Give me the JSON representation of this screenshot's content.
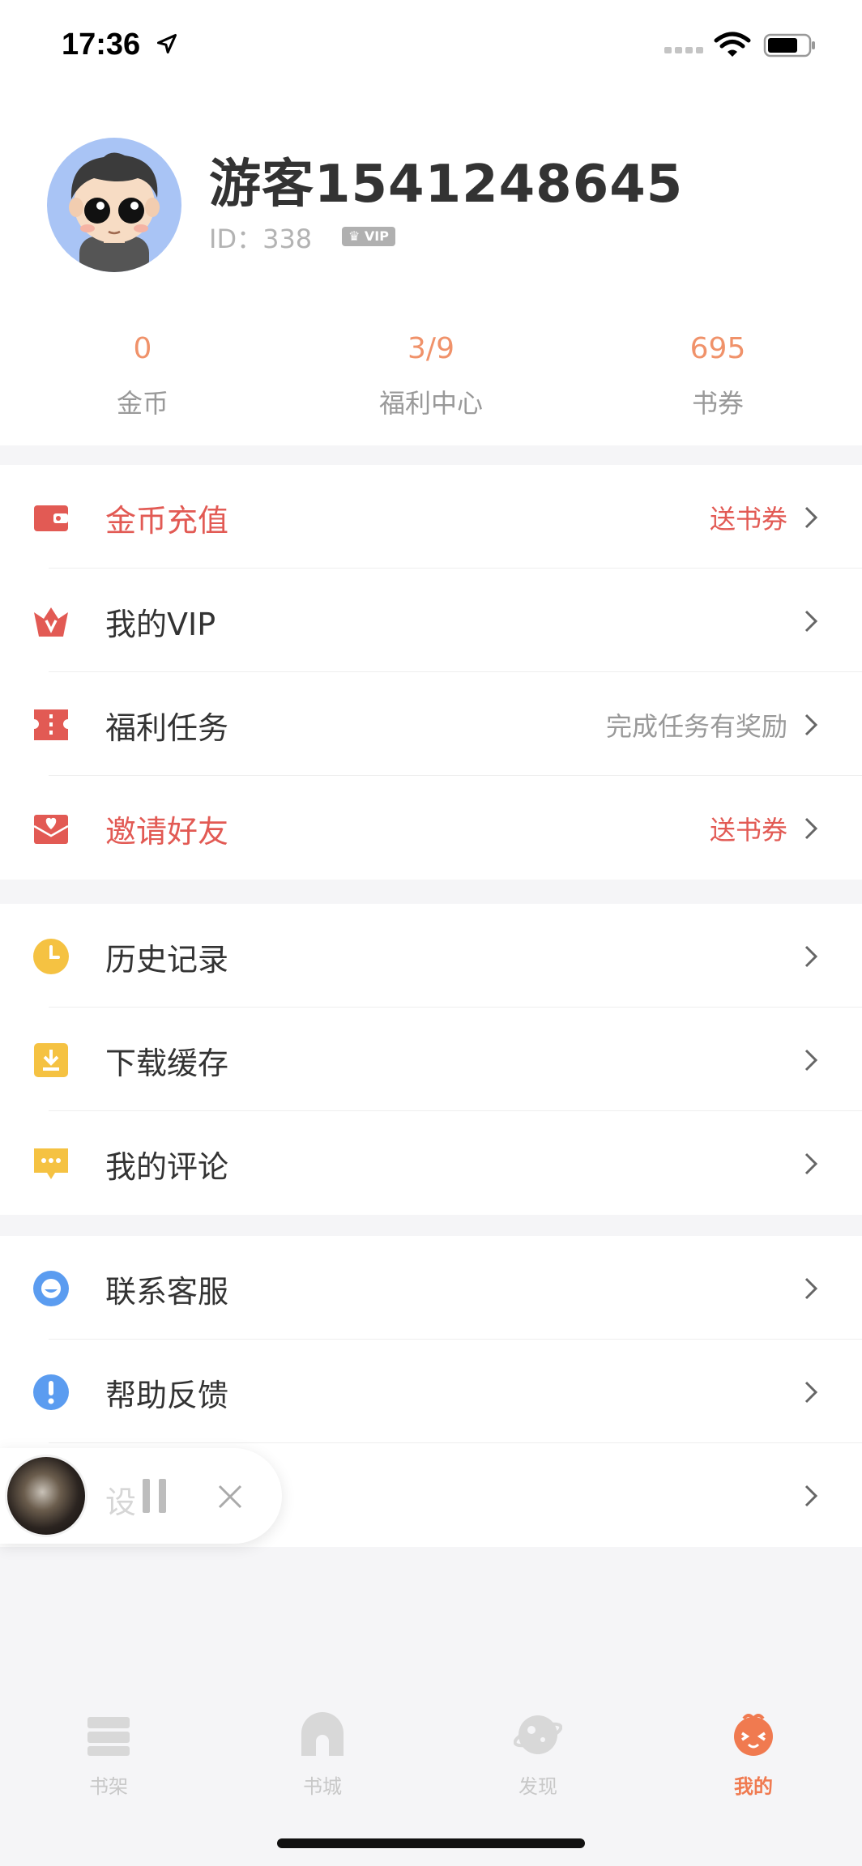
{
  "status_bar": {
    "time": "17:36"
  },
  "profile": {
    "username": "游客1541248645",
    "id_text": "ID：338",
    "vip_badge": "VIP"
  },
  "stats": [
    {
      "value": "0",
      "label": "金币"
    },
    {
      "value": "3/9",
      "label": "福利中心"
    },
    {
      "value": "695",
      "label": "书券"
    }
  ],
  "menu_group_1": [
    {
      "label": "金币充值",
      "extra": "送书券",
      "icon": "wallet-icon",
      "accent": "#e25a54"
    },
    {
      "label": "我的VIP",
      "extra": "",
      "icon": "vip-crown-icon",
      "accent": "#e25a54"
    },
    {
      "label": "福利任务",
      "extra": "完成任务有奖励",
      "icon": "ticket-icon",
      "accent": "#e25a54"
    },
    {
      "label": "邀请好友",
      "extra": "送书券",
      "icon": "invite-envelope-icon",
      "accent": "#e25a54"
    }
  ],
  "menu_group_2": [
    {
      "label": "历史记录",
      "icon": "clock-icon",
      "accent": "#f5c242"
    },
    {
      "label": "下载缓存",
      "icon": "download-icon",
      "accent": "#f5c242"
    },
    {
      "label": "我的评论",
      "icon": "comment-icon",
      "accent": "#f5c242"
    }
  ],
  "menu_group_3": [
    {
      "label": "联系客服",
      "icon": "customer-service-icon",
      "accent": "#5b9cf0"
    },
    {
      "label": "帮助反馈",
      "icon": "help-icon",
      "accent": "#5b9cf0"
    },
    {
      "label": "设置",
      "icon": "settings-icon"
    }
  ],
  "player": {
    "ghost_text": "设"
  },
  "tabs": [
    {
      "label": "书架",
      "icon": "bookshelf-icon"
    },
    {
      "label": "书城",
      "icon": "bookstore-icon"
    },
    {
      "label": "发现",
      "icon": "discover-icon"
    },
    {
      "label": "我的",
      "icon": "profile-icon",
      "active": true
    }
  ],
  "colors": {
    "accent": "#f07a50",
    "red": "#e25a54",
    "yellow": "#f5c242",
    "blue": "#5b9cf0"
  }
}
